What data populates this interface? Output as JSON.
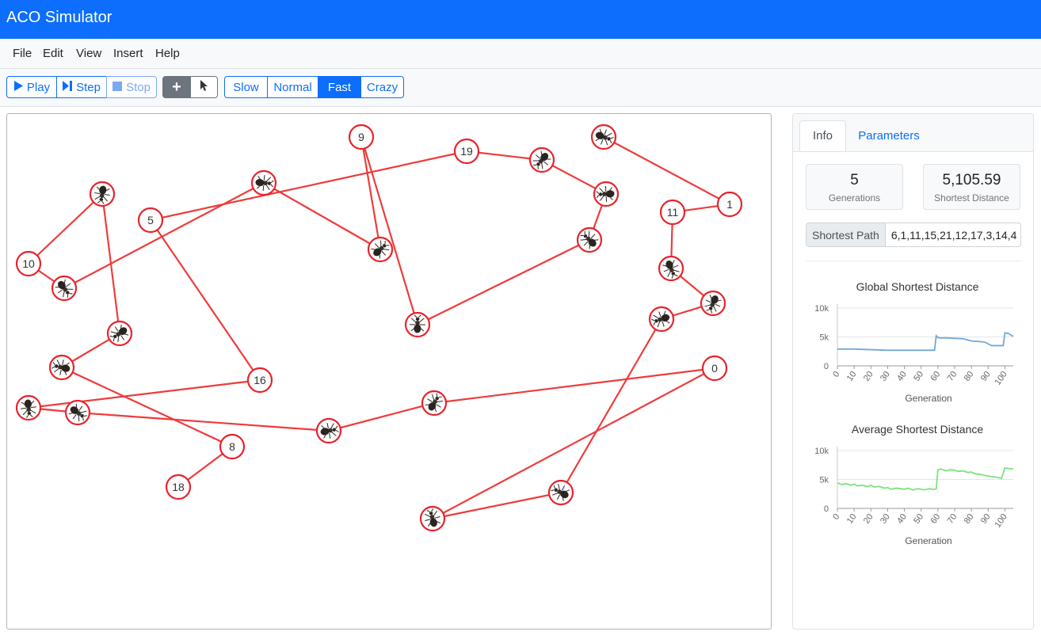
{
  "app": {
    "title": "ACO Simulator"
  },
  "menu": [
    "File",
    "Edit",
    "View",
    "Insert",
    "Help"
  ],
  "toolbar": {
    "play": "Play",
    "step": "Step",
    "stop": "Stop",
    "speeds": [
      "Slow",
      "Normal",
      "Fast",
      "Crazy"
    ],
    "active_speed": "Fast",
    "icons": {
      "add": "plus-icon",
      "select": "cursor-icon"
    }
  },
  "graph": {
    "nodes": [
      {
        "id": "0",
        "label": "0",
        "ant": false
      },
      {
        "id": "1",
        "label": "1",
        "ant": false
      },
      {
        "id": "5",
        "label": "5",
        "ant": false
      },
      {
        "id": "8",
        "label": "8",
        "ant": false
      },
      {
        "id": "9",
        "label": "9",
        "ant": false
      },
      {
        "id": "10",
        "label": "10",
        "ant": false
      },
      {
        "id": "11",
        "label": "11",
        "ant": false
      },
      {
        "id": "16",
        "label": "16",
        "ant": false
      },
      {
        "id": "18",
        "label": "18",
        "ant": false
      },
      {
        "id": "19",
        "label": "19",
        "ant": false
      },
      {
        "id": "a1",
        "label": "",
        "ant": true
      },
      {
        "id": "a2",
        "label": "",
        "ant": true
      },
      {
        "id": "a3",
        "label": "",
        "ant": true
      },
      {
        "id": "a4",
        "label": "",
        "ant": true
      },
      {
        "id": "a5",
        "label": "",
        "ant": true
      },
      {
        "id": "a6",
        "label": "",
        "ant": true
      },
      {
        "id": "a7",
        "label": "",
        "ant": true
      },
      {
        "id": "a8",
        "label": "",
        "ant": true
      },
      {
        "id": "a9",
        "label": "",
        "ant": true
      },
      {
        "id": "a10",
        "label": "",
        "ant": true
      },
      {
        "id": "a11",
        "label": "",
        "ant": true
      },
      {
        "id": "a12",
        "label": "",
        "ant": true
      },
      {
        "id": "a13",
        "label": "",
        "ant": true
      },
      {
        "id": "a14",
        "label": "",
        "ant": true
      },
      {
        "id": "a15",
        "label": "",
        "ant": true
      },
      {
        "id": "a16",
        "label": "",
        "ant": true
      },
      {
        "id": "a17",
        "label": "",
        "ant": true
      },
      {
        "id": "a18",
        "label": "",
        "ant": true
      },
      {
        "id": "a19",
        "label": "",
        "ant": true
      },
      {
        "id": "a20",
        "label": "",
        "ant": true
      }
    ],
    "edges": [
      [
        "a1",
        "1"
      ],
      [
        "1",
        "11"
      ],
      [
        "11",
        "a2"
      ],
      [
        "a2",
        "a3"
      ],
      [
        "a3",
        "a4"
      ],
      [
        "a4",
        "a5"
      ],
      [
        "a5",
        "a6"
      ],
      [
        "a6",
        "0"
      ],
      [
        "0",
        "a7"
      ],
      [
        "a7",
        "a8"
      ],
      [
        "a8",
        "a9"
      ],
      [
        "a9",
        "a10"
      ],
      [
        "a10",
        "16"
      ],
      [
        "16",
        "5"
      ],
      [
        "5",
        "19"
      ],
      [
        "19",
        "a11"
      ],
      [
        "a11",
        "a12"
      ],
      [
        "a12",
        "a13"
      ],
      [
        "a13",
        "a14"
      ],
      [
        "a14",
        "9"
      ],
      [
        "9",
        "a15"
      ],
      [
        "a15",
        "a16"
      ],
      [
        "a16",
        "a17"
      ],
      [
        "a17",
        "10"
      ],
      [
        "10",
        "a18"
      ],
      [
        "a18",
        "a19"
      ],
      [
        "a19",
        "a20"
      ],
      [
        "a20",
        "8"
      ],
      [
        "8",
        "18"
      ],
      [
        "18",
        "a21"
      ]
    ]
  },
  "panel": {
    "tabs": [
      "Info",
      "Parameters"
    ],
    "generations_value": "5",
    "generations_label": "Generations",
    "shortest_value": "5,105.59",
    "shortest_label": "Shortest Distance",
    "path_label": "Shortest Path",
    "path_value": "6,1,11,15,21,12,17,3,14,4"
  },
  "chart_data": [
    {
      "type": "line",
      "title": "Global Shortest Distance",
      "xlabel": "Generation",
      "ylabel": "",
      "xlim": [
        0,
        105
      ],
      "ylim": [
        0,
        10000
      ],
      "xticks": [
        0,
        10,
        20,
        30,
        40,
        50,
        60,
        70,
        80,
        90,
        100
      ],
      "yticks": [
        0,
        5000,
        10000
      ],
      "ytick_labels": [
        "0",
        "5k",
        "10k"
      ],
      "grid": true,
      "color": "#6fa8dc",
      "x": [
        0,
        10,
        15,
        20,
        25,
        30,
        40,
        50,
        57,
        58,
        59,
        60,
        62,
        65,
        70,
        75,
        80,
        85,
        88,
        90,
        92,
        95,
        98,
        99,
        100,
        102,
        105
      ],
      "y": [
        2900,
        2900,
        2850,
        2800,
        2750,
        2700,
        2700,
        2700,
        2700,
        2700,
        5200,
        4900,
        4800,
        4850,
        4750,
        4700,
        4300,
        4200,
        4100,
        3800,
        3500,
        3500,
        3500,
        3500,
        5700,
        5600,
        5100
      ]
    },
    {
      "type": "line",
      "title": "Average Shortest Distance",
      "xlabel": "Generation",
      "ylabel": "",
      "xlim": [
        0,
        105
      ],
      "ylim": [
        0,
        10000
      ],
      "xticks": [
        0,
        10,
        20,
        30,
        40,
        50,
        60,
        70,
        80,
        90,
        100
      ],
      "yticks": [
        0,
        5000,
        10000
      ],
      "ytick_labels": [
        "0",
        "5k",
        "10k"
      ],
      "grid": true,
      "color": "#7be37b",
      "x": [
        0,
        3,
        5,
        8,
        10,
        12,
        15,
        18,
        20,
        22,
        25,
        28,
        30,
        32,
        35,
        38,
        40,
        42,
        45,
        48,
        50,
        52,
        55,
        57,
        58,
        59,
        60,
        62,
        65,
        68,
        70,
        72,
        75,
        78,
        80,
        82,
        85,
        88,
        90,
        92,
        95,
        98,
        100,
        102,
        105
      ],
      "y": [
        4400,
        4100,
        4300,
        4000,
        4200,
        3900,
        4000,
        3800,
        4000,
        3700,
        3800,
        3500,
        3600,
        3300,
        3500,
        3400,
        3300,
        3500,
        3200,
        3400,
        3300,
        3200,
        3400,
        3300,
        3300,
        3400,
        6700,
        6800,
        6500,
        6700,
        6600,
        6400,
        6500,
        6200,
        6300,
        6000,
        5900,
        5700,
        5600,
        5500,
        5400,
        5200,
        7000,
        6900,
        6800
      ]
    }
  ]
}
